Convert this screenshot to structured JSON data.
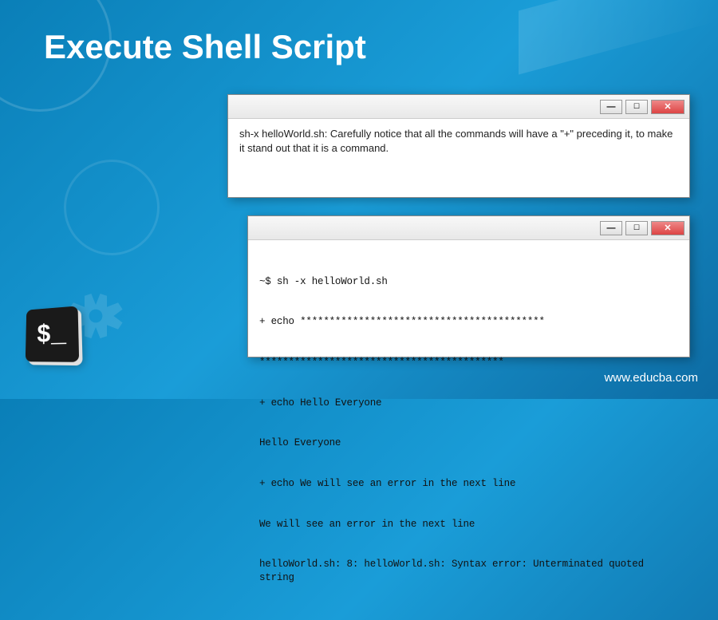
{
  "title": "Execute Shell Script",
  "window1": {
    "content": "sh-x helloWorld.sh: Carefully notice that all the commands will have a \"+\" preceding it, to make it stand out that it is a command."
  },
  "window2": {
    "lines": {
      "l0": "~$ sh -x helloWorld.sh",
      "l1": "+ echo ******************************************",
      "l2": "******************************************",
      "l3": "+ echo Hello Everyone",
      "l4": "Hello Everyone",
      "l5": "+ echo We will see an error in the next line",
      "l6": "We will see an error in the next line",
      "l7": "helloWorld.sh: 8: helloWorld.sh: Syntax error: Unterminated quoted string"
    }
  },
  "controls": {
    "minimize": "—",
    "maximize": "☐",
    "close": "✕"
  },
  "shell_prompt": "$_",
  "website": "www.educba.com"
}
